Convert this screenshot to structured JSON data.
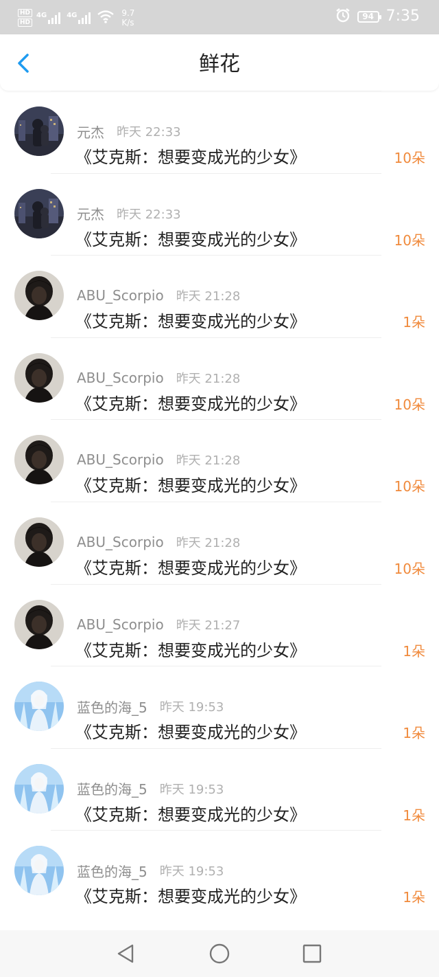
{
  "status_bar": {
    "hd_top": "HD",
    "hd_bottom": "HD",
    "signal1_label": "4G",
    "signal2_label": "4G",
    "net_speed_value": "9.7",
    "net_speed_unit": "K/s",
    "battery": "94",
    "time": "7:35"
  },
  "header": {
    "title": "鲜花"
  },
  "list": [
    {
      "username": "元杰",
      "time": "昨天 22:33",
      "title": "《艾克斯：想要变成光的少女》",
      "count": "10朵",
      "avatar": "dark-city"
    },
    {
      "username": "元杰",
      "time": "昨天 22:33",
      "title": "《艾克斯：想要变成光的少女》",
      "count": "10朵",
      "avatar": "dark-city"
    },
    {
      "username": "ABU_Scorpio",
      "time": "昨天 21:28",
      "title": "《艾克斯：想要变成光的少女》",
      "count": "1朵",
      "avatar": "dark-portrait"
    },
    {
      "username": "ABU_Scorpio",
      "time": "昨天 21:28",
      "title": "《艾克斯：想要变成光的少女》",
      "count": "10朵",
      "avatar": "dark-portrait"
    },
    {
      "username": "ABU_Scorpio",
      "time": "昨天 21:28",
      "title": "《艾克斯：想要变成光的少女》",
      "count": "10朵",
      "avatar": "dark-portrait"
    },
    {
      "username": "ABU_Scorpio",
      "time": "昨天 21:28",
      "title": "《艾克斯：想要变成光的少女》",
      "count": "10朵",
      "avatar": "dark-portrait"
    },
    {
      "username": "ABU_Scorpio",
      "time": "昨天 21:27",
      "title": "《艾克斯：想要变成光的少女》",
      "count": "1朵",
      "avatar": "dark-portrait"
    },
    {
      "username": "蓝色的海_5",
      "time": "昨天 19:53",
      "title": "《艾克斯：想要变成光的少女》",
      "count": "1朵",
      "avatar": "blue-anime"
    },
    {
      "username": "蓝色的海_5",
      "time": "昨天 19:53",
      "title": "《艾克斯：想要变成光的少女》",
      "count": "1朵",
      "avatar": "blue-anime"
    },
    {
      "username": "蓝色的海_5",
      "time": "昨天 19:53",
      "title": "《艾克斯：想要变成光的少女》",
      "count": "1朵",
      "avatar": "blue-anime"
    }
  ],
  "icons": {
    "back": "back-arrow-icon",
    "nav_back": "triangle-back-icon",
    "nav_home": "circle-home-icon",
    "nav_recent": "square-recent-icon"
  },
  "colors": {
    "accent_blue": "#1e9bf0",
    "count_orange": "#f08a3c",
    "status_bar_bg": "#d6d6d6"
  }
}
